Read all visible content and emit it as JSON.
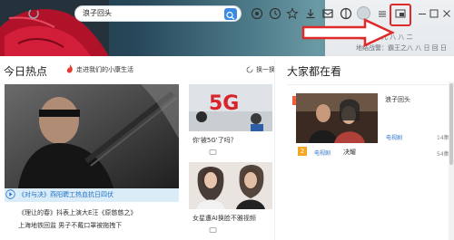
{
  "toolbar": {
    "address_text": "浪子回头"
  },
  "banner": {
    "side_line_1": "- 霸王之 儿 八 八 二",
    "side_line_2": "地结战警：霸王之八 八 日 回 日"
  },
  "main": {
    "today_title": "今日热点",
    "hot_link": "走进我们的小康生活",
    "refresh_label": "换一换",
    "hero_caption": "《对与决》燕阳聘工热血抗日四伏",
    "left_list": [
      "《理让的春》抖表上演大E汪《原慈慈之》",
      "上海地铁回监 男子不戴口罩被拖拽下"
    ],
    "news": [
      {
        "title": "你'被5G'了吗？",
        "count": ""
      },
      {
        "title": "女星遭AI换脸不雅视频",
        "count": ""
      }
    ]
  },
  "sidebar": {
    "title": "大家都在看",
    "items": [
      {
        "rank": "1",
        "title": "浪子回头",
        "tag": "电视剧",
        "count": "14集"
      },
      {
        "rank": "2",
        "tag": "电视剧",
        "title": "决耀",
        "count": "54集"
      }
    ]
  }
}
